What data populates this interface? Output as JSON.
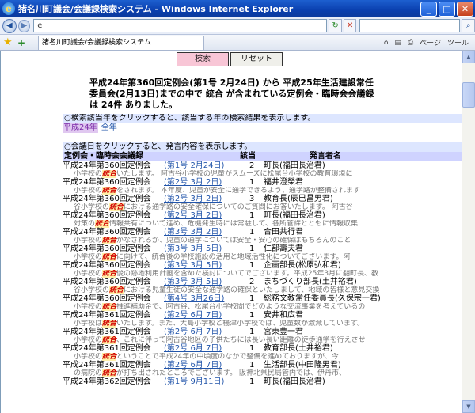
{
  "window": {
    "title": "猪名川町議会/会議録検索システム - Windows Internet Explorer",
    "tab_title": "猪名川町議会/会議録検索システム"
  },
  "browser": {
    "address": "e",
    "tools": [
      "ページ",
      "ツール"
    ]
  },
  "form": {
    "search_label": "検索",
    "reset_label": "リセット"
  },
  "summary": "平成24年第360回定例会(第1号 2月24日) から 平成25年生活建設常任委員会(2月13日)までの中で 統合 が含まれている定例会・臨時会会議録は 24件 ありました。",
  "notice_years": "○検索該当年をクリックすると、該当する年の検索結果を表示します。",
  "year_filters": {
    "selected": "平成24年",
    "all": "全年"
  },
  "notice_dates": "○会議日をクリックすると、発言内容を表示します。",
  "table": {
    "headers": {
      "session": "定例会・臨時会会議録",
      "relevance": "該当",
      "speaker": "発言者名"
    },
    "rows": [
      {
        "session": "平成24年第360回定例会",
        "date": "(第1号 2月24日)",
        "count": "2",
        "speaker": "町長(福田長治君)",
        "pre": "小学校の",
        "term": "統合",
        "post": "いたします。 阿古谷小学校の児童がスムーズに松尾台小学校の教育環境に"
      },
      {
        "session": "平成24年第360回定例会",
        "date": "(第2号 3月 2日)",
        "count": "1",
        "speaker": "福井澄榮君",
        "pre": "小学校の",
        "term": "統合",
        "post": "をされます。 本年度、児童が安全に通学できるよう、通学路が整備されます"
      },
      {
        "session": "平成24年第360回定例会",
        "date": "(第2号 3月 2日)",
        "count": "3",
        "speaker": "教育長(辰巳昌男君)",
        "pre": "谷小学校の",
        "term": "統合",
        "post": "における通学路の安全確保についてのご質問にお答いたします。 阿古谷"
      },
      {
        "session": "平成24年第360回定例会",
        "date": "(第2号 3月 2日)",
        "count": "1",
        "speaker": "町長(福田長治君)",
        "pre": "対策の",
        "term": "統合",
        "post": "情報共有について進め、危機発生時には常駐して、各所管課とともに情報収集"
      },
      {
        "session": "平成24年第360回定例会",
        "date": "(第3号 3月 2日)",
        "count": "1",
        "speaker": "合田共行君",
        "pre": "小学校の",
        "term": "統合",
        "post": "がなされるが、児童の通学については安全・安心の確保はもちろんのこと"
      },
      {
        "session": "平成24年第360回定例会",
        "date": "(第3号 3月 5日)",
        "count": "1",
        "speaker": "仁部壽夫君",
        "pre": "小学校の",
        "term": "統合",
        "post": "に向けて、統合後の学校施設の活用と地域活性化についてございます。阿"
      },
      {
        "session": "平成24年第360回定例会",
        "date": "(第3号 3月 5日)",
        "count": "1",
        "speaker": "企画部長(松原弘和君)",
        "pre": "小学校の",
        "term": "統合",
        "post": "後の跡地利用計画を含めた検討についてでございます。平成25年3月に翻町長、教"
      },
      {
        "session": "平成24年第360回定例会",
        "date": "(第3号 3月 5日)",
        "count": "2",
        "speaker": "まちづくり部長(土井裕君)",
        "pre": "谷小学校の",
        "term": "統合",
        "post": "における児童生徒の安全な通学路の確保といたしまして、地域の皆様と意見交換"
      },
      {
        "session": "平成24年第360回定例会",
        "date": "(第4号 3月26日)",
        "count": "1",
        "speaker": "総務文教常任委員長(久保宗一君)",
        "pre": "小学校の",
        "term": "統合",
        "post": "推進補助金で、阿古谷、松尾台小学校間でどのような交流事業を考えているの"
      },
      {
        "session": "平成24年第361回定例会",
        "date": "(第2号 6月 7日)",
        "count": "1",
        "speaker": "安井和広君",
        "pre": "小学校は",
        "term": "統合",
        "post": "いたします。また、大島小学校と楊津小学校では、児童数が激減しています。"
      },
      {
        "session": "平成24年第361回定例会",
        "date": "(第2号 6月 7日)",
        "count": "1",
        "speaker": "宮東豊一君",
        "pre": "小学校の",
        "term": "統合",
        "post": "、これに伴って阿古谷地区の子供たちには長い長い距離の徒歩通学を行えさせ"
      },
      {
        "session": "平成24年第361回定例会",
        "date": "(第2号 6月 7日)",
        "count": "1",
        "speaker": "教育部長(土井裕君)",
        "pre": "小学校の",
        "term": "統合",
        "post": "ということで平成24年の中頃度のなかで整備を進めておりますが、今"
      },
      {
        "session": "平成24年第361回定例会",
        "date": "(第2号 6月 7日)",
        "count": "1",
        "speaker": "生活部長(中田隆男君)",
        "pre": "の病院の",
        "term": "統合",
        "post": "が打ち出されたところでございます。 阪神北県民局管内では、伊丹市、"
      },
      {
        "session": "平成24年第362回定例会",
        "date": "(第1号 9月11日)",
        "count": "1",
        "speaker": "町長(福田長治君)",
        "pre": "",
        "term": "",
        "post": ""
      }
    ]
  }
}
